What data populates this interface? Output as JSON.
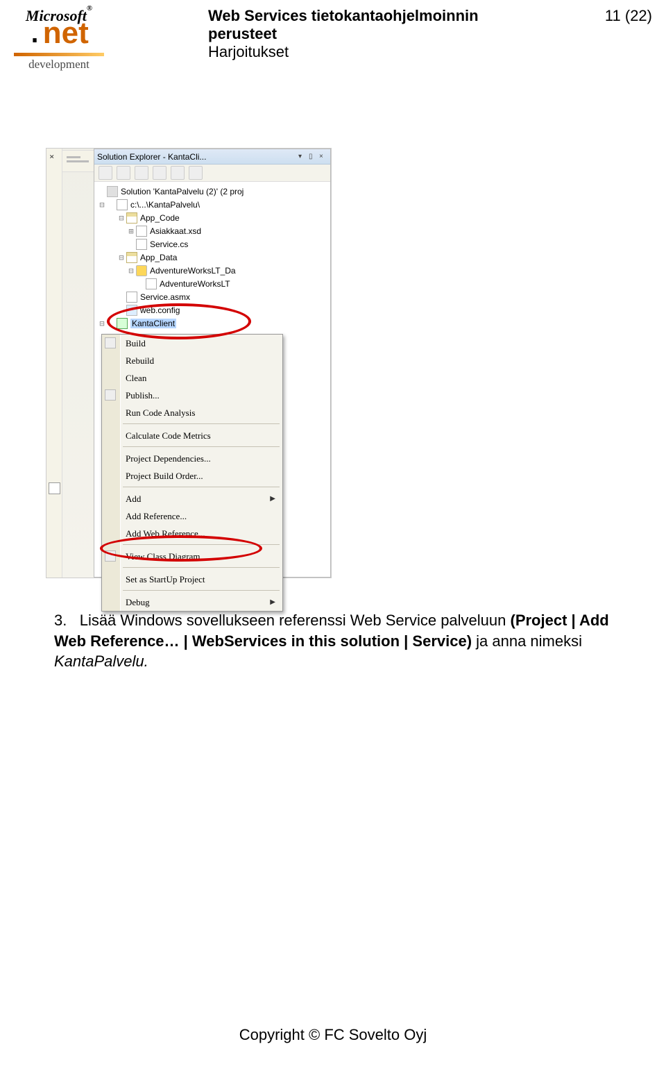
{
  "header": {
    "title_line1": "Web Services tietokantaohjelmoinnin",
    "title_line2": "perusteet",
    "title_line3": "Harjoitukset",
    "page_no": "11 (22)"
  },
  "logo": {
    "brand": "Microsoft",
    "reg": "®",
    "dot": ".",
    "net": "net",
    "dev": "development"
  },
  "solution_explorer": {
    "title": "Solution Explorer - KantaCli...",
    "solution": "Solution 'KantaPalvelu (2)' (2 proj",
    "project_path": "c:\\...\\KantaPalvelu\\",
    "nodes": {
      "app_code": "App_Code",
      "asiakkaat": "Asiakkaat.xsd",
      "service_cs": "Service.cs",
      "app_data": "App_Data",
      "advdb": "AdventureWorksLT_Da",
      "advlog": "AdventureWorksLT",
      "service_asmx": "Service.asmx",
      "web_config": "web.config",
      "kanta_client": "KantaClient"
    }
  },
  "context_menu": {
    "items": [
      {
        "label": "Build"
      },
      {
        "label": "Rebuild"
      },
      {
        "label": "Clean"
      },
      {
        "label": "Publish..."
      },
      {
        "label": "Run Code Analysis"
      },
      {
        "sep": true
      },
      {
        "label": "Calculate Code Metrics"
      },
      {
        "sep": true
      },
      {
        "label": "Project Dependencies..."
      },
      {
        "label": "Project Build Order..."
      },
      {
        "sep": true
      },
      {
        "label": "Add",
        "submenu": true
      },
      {
        "label": "Add Reference..."
      },
      {
        "label": "Add Web Reference..."
      },
      {
        "sep": true
      },
      {
        "label": "View Class Diagram"
      },
      {
        "sep": true
      },
      {
        "label": "Set as StartUp Project"
      },
      {
        "sep": true
      },
      {
        "label": "Debug",
        "submenu": true
      }
    ]
  },
  "body": {
    "num": "3.",
    "text1": "Lisää Windows sovellukseen referenssi Web Service palveluun ",
    "text2": "(Project | Add Web Reference… | WebServices in this solution | Service)",
    "text3": " ja anna nimeksi ",
    "text4": "KantaPalvelu."
  },
  "footer": "Copyright © FC Sovelto Oyj"
}
